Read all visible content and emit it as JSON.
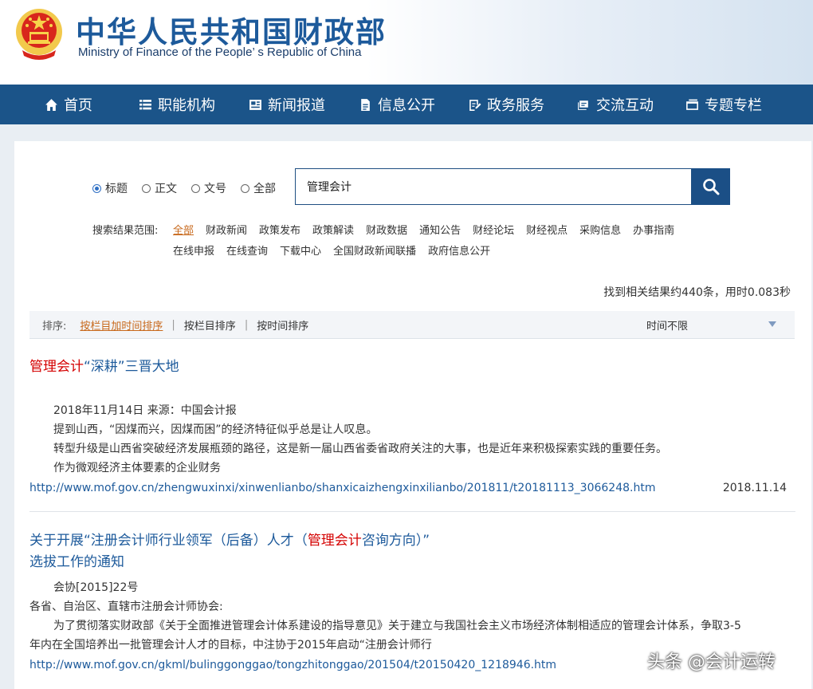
{
  "header": {
    "title": "中华人民共和国财政部",
    "subtitle": "Ministry of Finance of the People’ s Republic of China"
  },
  "nav": [
    {
      "label": "首页",
      "icon": "home-icon"
    },
    {
      "label": "职能机构",
      "icon": "list-icon"
    },
    {
      "label": "新闻报道",
      "icon": "newspaper-icon"
    },
    {
      "label": "信息公开",
      "icon": "document-icon"
    },
    {
      "label": "政务服务",
      "icon": "clipboard-icon"
    },
    {
      "label": "交流互动",
      "icon": "chat-icon"
    },
    {
      "label": "专题专栏",
      "icon": "window-icon"
    }
  ],
  "search": {
    "options": [
      "标题",
      "正文",
      "文号",
      "全部"
    ],
    "selected": "标题",
    "query": "管理会计"
  },
  "scope": {
    "label": "搜索结果范围:",
    "row1": [
      "全部",
      "财政新闻",
      "政策发布",
      "政策解读",
      "财政数据",
      "通知公告",
      "财经论坛",
      "财经视点",
      "采购信息",
      "办事指南"
    ],
    "row2": [
      "在线申报",
      "在线查询",
      "下载中心",
      "全国财政新闻联播",
      "政府信息公开"
    ]
  },
  "result_count": "找到相关结果约440条，用时0.083秒",
  "sort": {
    "label": "排序:",
    "options": [
      "按栏目加时间排序",
      "按栏目排序",
      "按时间排序"
    ],
    "time_filter": "时间不限"
  },
  "results": [
    {
      "title_hl": "管理会计",
      "title_rest": "“深耕”三晋大地",
      "lines": [
        "2018年11月14日 来源：中国会计报",
        "提到山西，“因煤而兴，因煤而困”的经济特征似乎总是让人叹息。",
        "转型升级是山西省突破经济发展瓶颈的路径，这是新一届山西省委省政府关注的大事，也是近年来积极探索实践的重要任务。",
        "作为微观经济主体要素的企业财务"
      ],
      "url": "http://www.mof.gov.cn/zhengwuxinxi/xinwenlianbo/shanxicaizhengxinxilianbo/201811/t20181113_3066248.htm",
      "date": "2018.11.14"
    },
    {
      "title_pre": "关于开展“注册会计师行业领军（后备）人才（",
      "title_hl": "管理会计",
      "title_post": "咨询方向）”",
      "title_line2": "选拔工作的通知",
      "lines": [
        "会协[2015]22号",
        "各省、自治区、直辖市注册会计师协会:",
        "为了贯彻落实财政部《关于全面推进管理会计体系建设的指导意见》关于建立与我国社会主义市场经济体制相适应的管理会计体系，争取3-5",
        "年内在全国培养出一批管理会计人才的目标，中注协于2015年启动“注册会计师行"
      ],
      "url": "http://www.mof.gov.cn/gkml/bulinggonggao/tongzhitonggao/201504/t20150420_1218946.htm"
    }
  ],
  "watermark": "头条 @会计运转"
}
